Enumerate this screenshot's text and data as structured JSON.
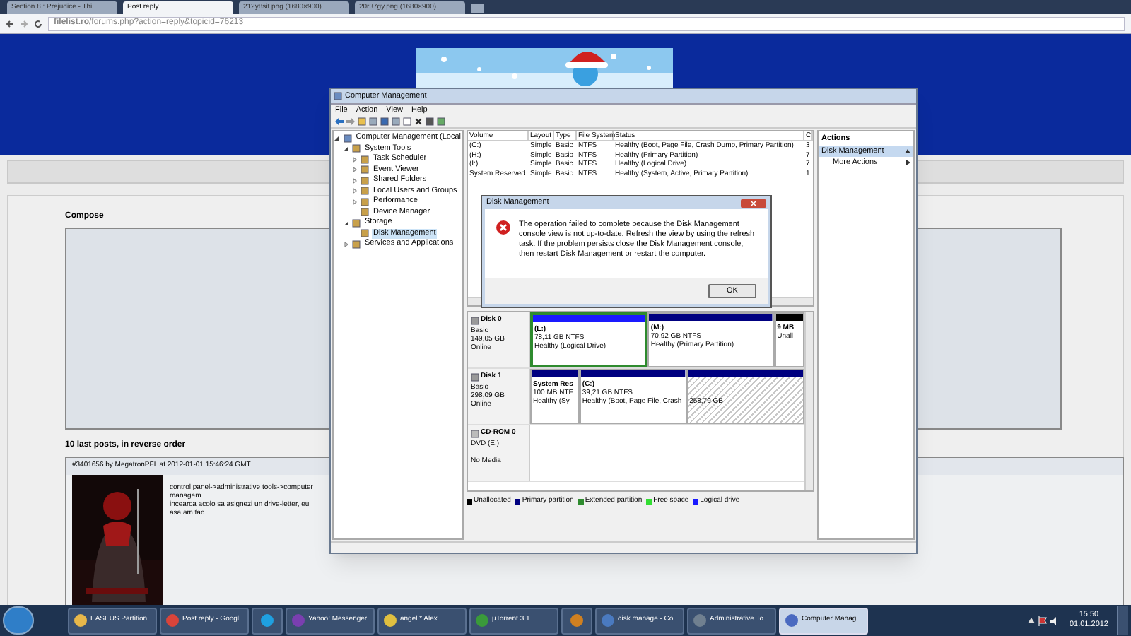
{
  "browser": {
    "tabs": [
      {
        "label": "Section 8 : Prejudice - Thi",
        "selected": false
      },
      {
        "label": "Post reply",
        "selected": true
      },
      {
        "label": "212y8sit.png (1680×900)",
        "selected": false
      },
      {
        "label": "20r37gy.png (1680×900)",
        "selected": false
      }
    ],
    "address": "**filelist.ro**/forums.php?action=reply&topicid=76213"
  },
  "forum": {
    "compose_label": "Compose",
    "posts_heading": "10 last posts, in reverse order",
    "post": {
      "header": "#3401656 by MegatronPFL at 2012-01-01 15:46:24 GMT",
      "lines": [
        "control panel->administrative tools->computer managem",
        "incearca acolo sa asignezi un drive-letter, eu asa am fac"
      ]
    }
  },
  "computer_management": {
    "title": "Computer Management",
    "menu": [
      "File",
      "Action",
      "View",
      "Help"
    ],
    "tree": [
      {
        "label": "Computer Management (Local",
        "expanded": true,
        "selected": false,
        "children": [
          {
            "label": "System Tools",
            "expanded": true,
            "selected": false,
            "children": [
              {
                "label": "Task Scheduler",
                "expanded": false,
                "selected": false
              },
              {
                "label": "Event Viewer",
                "expanded": false,
                "selected": false
              },
              {
                "label": "Shared Folders",
                "expanded": false,
                "selected": false
              },
              {
                "label": "Local Users and Groups",
                "expanded": false,
                "selected": false
              },
              {
                "label": "Performance",
                "expanded": false,
                "selected": false
              },
              {
                "label": "Device Manager",
                "selected": false
              }
            ]
          },
          {
            "label": "Storage",
            "expanded": true,
            "selected": false,
            "children": [
              {
                "label": "Disk Management",
                "selected": true
              }
            ]
          },
          {
            "label": "Services and Applications",
            "expanded": false,
            "selected": false
          }
        ]
      }
    ],
    "volumes": {
      "columns": [
        "Volume",
        "Layout",
        "Type",
        "File System",
        "Status",
        "C"
      ],
      "rows": [
        [
          "(C:)",
          "Simple",
          "Basic",
          "NTFS",
          "Healthy (Boot, Page File, Crash Dump, Primary Partition)",
          "3"
        ],
        [
          "(H:)",
          "Simple",
          "Basic",
          "NTFS",
          "Healthy (Primary Partition)",
          "7"
        ],
        [
          "(I:)",
          "Simple",
          "Basic",
          "NTFS",
          "Healthy (Logical Drive)",
          "7"
        ],
        [
          "System Reserved",
          "Simple",
          "Basic",
          "NTFS",
          "Healthy (System, Active, Primary Partition)",
          "1"
        ]
      ]
    },
    "disks": [
      {
        "name": "Disk 0",
        "kind": "disk",
        "lines": [
          "Basic",
          "149,05 GB",
          "Online"
        ],
        "partitions": [
          {
            "lines": [
              "(L:)",
              "78,11 GB NTFS",
              "Healthy (Logical Drive)"
            ],
            "color": "#1a1aff",
            "kind": "plain",
            "selected": true
          },
          {
            "lines": [
              "(M:)",
              "70,92 GB NTFS",
              "Healthy (Primary Partition)"
            ],
            "color": "#000080",
            "kind": "plain",
            "selected": false
          },
          {
            "lines": [
              "9 MB",
              "Unall"
            ],
            "color": "#000000",
            "kind": "plain",
            "selected": false
          }
        ]
      },
      {
        "name": "Disk 1",
        "kind": "disk",
        "lines": [
          "Basic",
          "298,09 GB",
          "Online"
        ],
        "partitions": [
          {
            "lines": [
              "System Res",
              "100 MB NTF",
              "Healthy (Sy"
            ],
            "color": "#000080",
            "kind": "plain",
            "selected": false
          },
          {
            "lines": [
              "(C:)",
              "39,21 GB NTFS",
              "Healthy (Boot, Page File, Crash"
            ],
            "color": "#000080",
            "kind": "plain",
            "selected": false
          },
          {
            "lines": [
              "258,79 GB"
            ],
            "color": "#000080",
            "kind": "hatched",
            "selected": false
          }
        ]
      },
      {
        "name": "CD-ROM 0",
        "kind": "cdrom",
        "lines": [
          "DVD (E:)",
          "No Media"
        ]
      }
    ],
    "legend": [
      {
        "label": "Unallocated",
        "color": "#000000"
      },
      {
        "label": "Primary partition",
        "color": "#000080"
      },
      {
        "label": "Extended partition",
        "color": "#2e8b2e"
      },
      {
        "label": "Free space",
        "color": "#33dd33"
      },
      {
        "label": "Logical drive",
        "color": "#1a1aff"
      }
    ],
    "actions": {
      "title": "Actions",
      "section": "Disk Management",
      "items": [
        "More Actions"
      ]
    }
  },
  "dialog": {
    "title": "Disk Management",
    "message": "The operation failed to complete because the Disk Management console view is not up-to-date.  Refresh the view by using the refresh task. If the problem persists close the Disk Management console, then restart Disk Management or restart the computer.",
    "button": "OK"
  },
  "taskbar": {
    "items": [
      {
        "label": "EASEUS Partition...",
        "selected": false
      },
      {
        "label": "Post reply - Googl...",
        "selected": false
      },
      {
        "selected": false
      },
      {
        "label": "Yahoo! Messenger",
        "selected": false
      },
      {
        "label": "angel.* Alex",
        "selected": false
      },
      {
        "label": "µTorrent 3.1",
        "selected": false
      },
      {
        "selected": false
      },
      {
        "label": "disk manage - Co...",
        "selected": false
      },
      {
        "label": "Administrative To...",
        "selected": false
      },
      {
        "label": "Computer Manag...",
        "selected": true
      }
    ],
    "time": "15:50",
    "date": "01.01.2012"
  }
}
